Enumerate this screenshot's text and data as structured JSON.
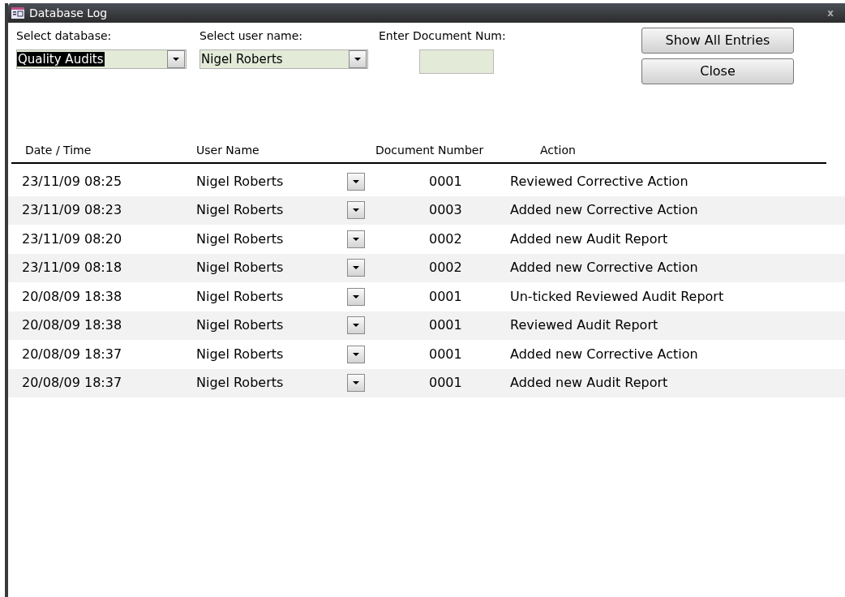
{
  "window": {
    "title": "Database Log",
    "close": "x"
  },
  "filters": [
    {
      "kind": "combo",
      "label": "Select database:",
      "value": "Quality Audits",
      "highlighted": true
    },
    {
      "kind": "combo",
      "label": "Select user name:",
      "value": "Nigel Roberts",
      "highlighted": false
    },
    {
      "kind": "text",
      "label": "Enter Document Num:"
    }
  ],
  "buttons": [
    "Show All Entries",
    "Close"
  ],
  "table": {
    "columns": [
      "Date / Time",
      "User Name",
      "Document Number",
      "Action"
    ],
    "rows": [
      {
        "date_time": "23/11/09 08:25",
        "user_name": "Nigel Roberts",
        "document_number": "0001",
        "action": "Reviewed Corrective Action"
      },
      {
        "date_time": "23/11/09 08:23",
        "user_name": "Nigel Roberts",
        "document_number": "0003",
        "action": "Added new Corrective Action"
      },
      {
        "date_time": "23/11/09 08:20",
        "user_name": "Nigel Roberts",
        "document_number": "0002",
        "action": "Added new Audit Report"
      },
      {
        "date_time": "23/11/09 08:18",
        "user_name": "Nigel Roberts",
        "document_number": "0002",
        "action": "Added new Corrective Action"
      },
      {
        "date_time": "20/08/09 18:38",
        "user_name": "Nigel Roberts",
        "document_number": "0001",
        "action": "Un-ticked Reviewed Audit Report"
      },
      {
        "date_time": "20/08/09 18:38",
        "user_name": "Nigel Roberts",
        "document_number": "0001",
        "action": "Reviewed Audit Report"
      },
      {
        "date_time": "20/08/09 18:37",
        "user_name": "Nigel Roberts",
        "document_number": "0001",
        "action": "Added new Corrective Action"
      },
      {
        "date_time": "20/08/09 18:37",
        "user_name": "Nigel Roberts",
        "document_number": "0001",
        "action": "Added new Audit Report"
      }
    ]
  }
}
